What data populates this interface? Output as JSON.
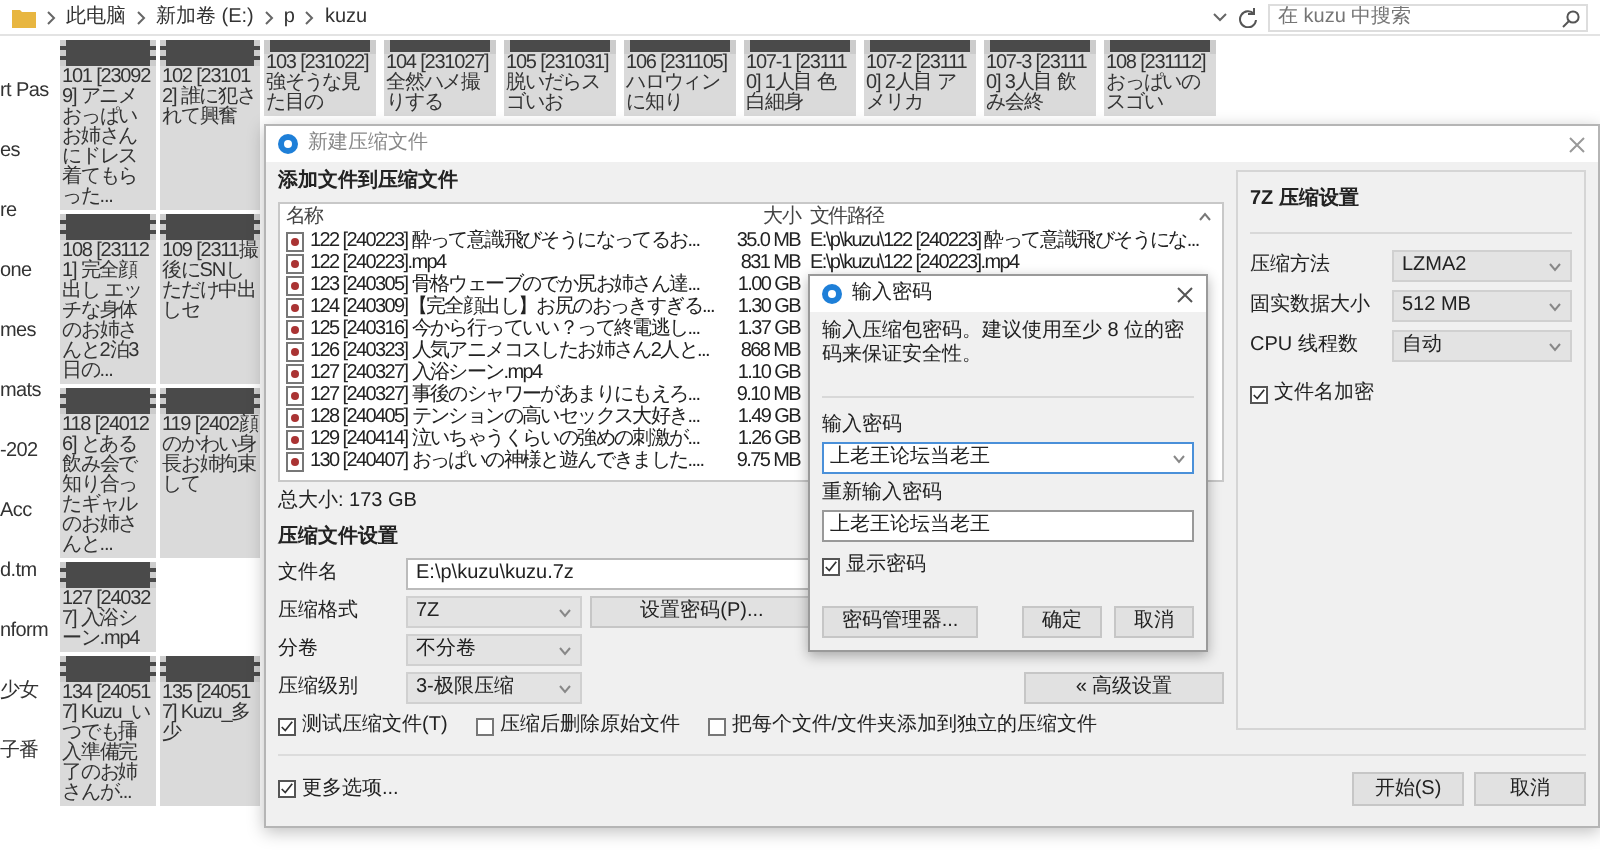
{
  "explorer": {
    "breadcrumb": [
      "此电脑",
      "新加卷 (E:)",
      "p",
      "kuzu"
    ],
    "search": {
      "placeholder": "在 kuzu 中搜索"
    },
    "nav_items": [
      "rt Pas",
      "es",
      "re",
      "one",
      "mes",
      "mats",
      "-202",
      "Acc",
      "d.tm",
      "nform",
      "少女",
      "子番"
    ],
    "tile_rows": [
      {
        "left": {
          "caption": "101 [230929] アニメおっぱいお姉さんにドレス着てもらった..."
        },
        "right": {
          "caption": "102 [231012] 誰に犯されて興奮"
        }
      },
      {
        "left": {
          "caption": "108 [231121] 完全顔出し エッチな身体のお姉さんと2泊3日の..."
        },
        "right": {
          "caption": "109 [2311撮後にSNしただけ中出しセ"
        }
      },
      {
        "left": {
          "caption": "118 [240126] とある飲み会で知り合ったギャルのお姉さんと..."
        },
        "right": {
          "caption": "119 [2402顔のかわい身長お姉拘束して"
        }
      },
      {
        "left": {
          "caption": "127 [240327] 入浴シーン.mp4"
        }
      },
      {
        "left": {
          "caption": "134 [240517] Kuzu_いつでも挿入準備完了のお姉さんが..."
        },
        "right": {
          "caption": "135 [240517] Kuzu_多少"
        }
      }
    ],
    "top_row": [
      {
        "caption": "103 [231022] 強そうな見た目の"
      },
      {
        "caption": "104 [231027] 全然ハメ撮りする"
      },
      {
        "caption": "105 [231031] 脱いだらスゴいお"
      },
      {
        "caption": "106 [231105] ハロウィンに知り"
      },
      {
        "caption": "107-1 [231110] 1人目 色白細身"
      },
      {
        "caption": "107-2 [231110] 2人目 アメリカ"
      },
      {
        "caption": "107-3 [231110] 3人目 飲み会終"
      },
      {
        "caption": "108 [231112] おっぱいのスゴい"
      }
    ]
  },
  "archive_dialog": {
    "title": "新建压缩文件",
    "files_heading": "添加文件到压缩文件",
    "columns": [
      "名称",
      "大小",
      "文件路径"
    ],
    "files": [
      {
        "name": "122 [240223] 酔って意識飛びそうになってるお...",
        "size": "35.0 MB",
        "path": "E:\\p\\kuzu\\122 [240223] 酔って意識飛びそうにな..."
      },
      {
        "name": "122 [240223].mp4",
        "size": "831 MB",
        "path": "E:\\p\\kuzu\\122 [240223].mp4"
      },
      {
        "name": "123 [240305] 骨格ウェーブのでか尻お姉さん達...",
        "size": "1.00 GB"
      },
      {
        "name": "124 [240309]【完全顔出し】お尻のおっきすぎる...",
        "size": "1.30 GB"
      },
      {
        "name": "125 [240316] 今から行っていい？って終電逃し...",
        "size": "1.37 GB"
      },
      {
        "name": "126 [240323] 人気アニメコスしたお姉さん2人と...",
        "size": "868 MB"
      },
      {
        "name": "127 [240327] 入浴シーン.mp4",
        "size": "1.10 GB"
      },
      {
        "name": "127 [240327] 事後のシャワーがあまりにもえろ...",
        "size": "9.10 MB"
      },
      {
        "name": "128 [240405] テンションの高いセックス大好き...",
        "size": "1.49 GB"
      },
      {
        "name": "129 [240414] 泣いちゃうくらいの強めの刺激が...",
        "size": "1.26 GB"
      },
      {
        "name": "130 [240407] おっぱいの神様と遊んできました....",
        "size": "9.75 MB"
      }
    ],
    "total": "总大小: 173 GB",
    "settings_heading": "压缩文件设置",
    "filename": {
      "label": "文件名",
      "value": "E:\\p\\kuzu\\kuzu.7z"
    },
    "format": {
      "label": "压缩格式",
      "value": "7Z"
    },
    "set_password_button": "设置密码(P)...",
    "split": {
      "label": "分卷",
      "value": "不分卷"
    },
    "level": {
      "label": "压缩级别",
      "value": "3-极限压缩"
    },
    "advanced_button": "« 高级设置",
    "options": [
      {
        "label": "测试压缩文件(T)",
        "checked": true
      },
      {
        "label": "压缩后删除原始文件",
        "checked": false
      },
      {
        "label": "把每个文件/文件夹添加到独立的压缩文件",
        "checked": false
      }
    ],
    "more_options": {
      "label": "更多选项...",
      "checked": true
    },
    "panel": {
      "heading": "7Z 压缩设置",
      "settings": [
        {
          "label": "压缩方法",
          "value": "LZMA2"
        },
        {
          "label": "固实数据大小",
          "value": "512 MB"
        },
        {
          "label": "CPU 线程数",
          "value": "自动"
        }
      ],
      "encrypt_names": {
        "label": "文件名加密",
        "checked": true
      }
    },
    "start_button": "开始(S)",
    "cancel_button": "取消"
  },
  "password_dialog": {
    "title": "输入密码",
    "message": "输入压缩包密码。建议使用至少 8 位的密码来保证安全性。",
    "password_label": "输入密码",
    "password": "上老王论坛当老王",
    "confirm_label": "重新输入密码",
    "confirm": "上老王论坛当老王",
    "show_password": {
      "label": "显示密码",
      "checked": true
    },
    "buttons": [
      "密码管理器...",
      "确定",
      "取消"
    ]
  }
}
